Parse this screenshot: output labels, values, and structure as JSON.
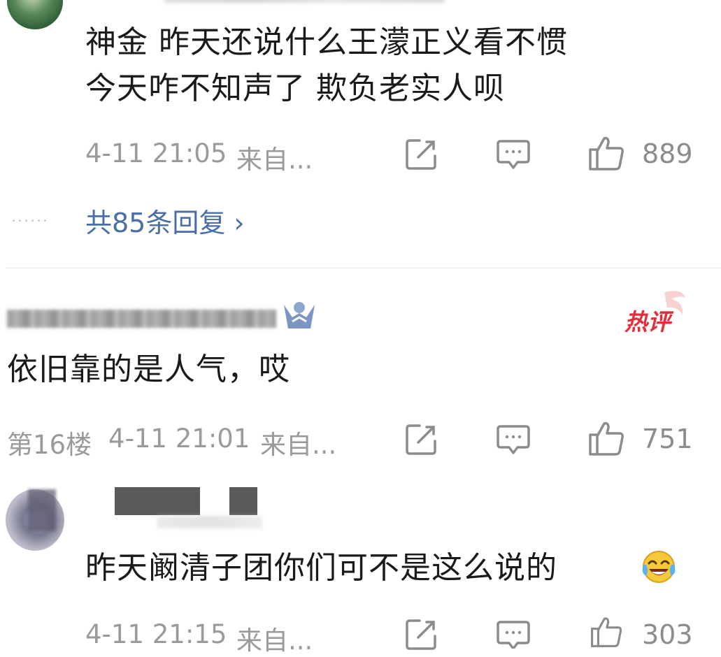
{
  "comments": [
    {
      "text_line1": "神金 昨天还说什么王濛正义看不惯",
      "text_line2": "今天咋不知声了 欺负老实人呗",
      "time": "4-11 21:05",
      "source": "来自...",
      "likes": "889",
      "replies_dots": "......",
      "replies_label": "共85条回复 ›"
    },
    {
      "badge": "热评",
      "text": "依旧靠的是人气，哎",
      "floor": "第16楼",
      "time": "4-11 21:01",
      "source": "来自...",
      "likes": "751"
    },
    {
      "text": "昨天阚清子团你们可不是这么说的",
      "emoji": "laughing-crying-emoji",
      "time": "4-11 21:15",
      "source": "来自...",
      "likes": "303"
    }
  ],
  "icons": {
    "share": "share-edit-icon",
    "comment": "comment-bubble-icon",
    "like": "thumbs-up-icon",
    "vip": "vip-person-icon"
  },
  "colors": {
    "text": "#1a1a1a",
    "meta": "#9a9a9a",
    "link": "#4a6ea8",
    "hot": "#e0303a"
  }
}
